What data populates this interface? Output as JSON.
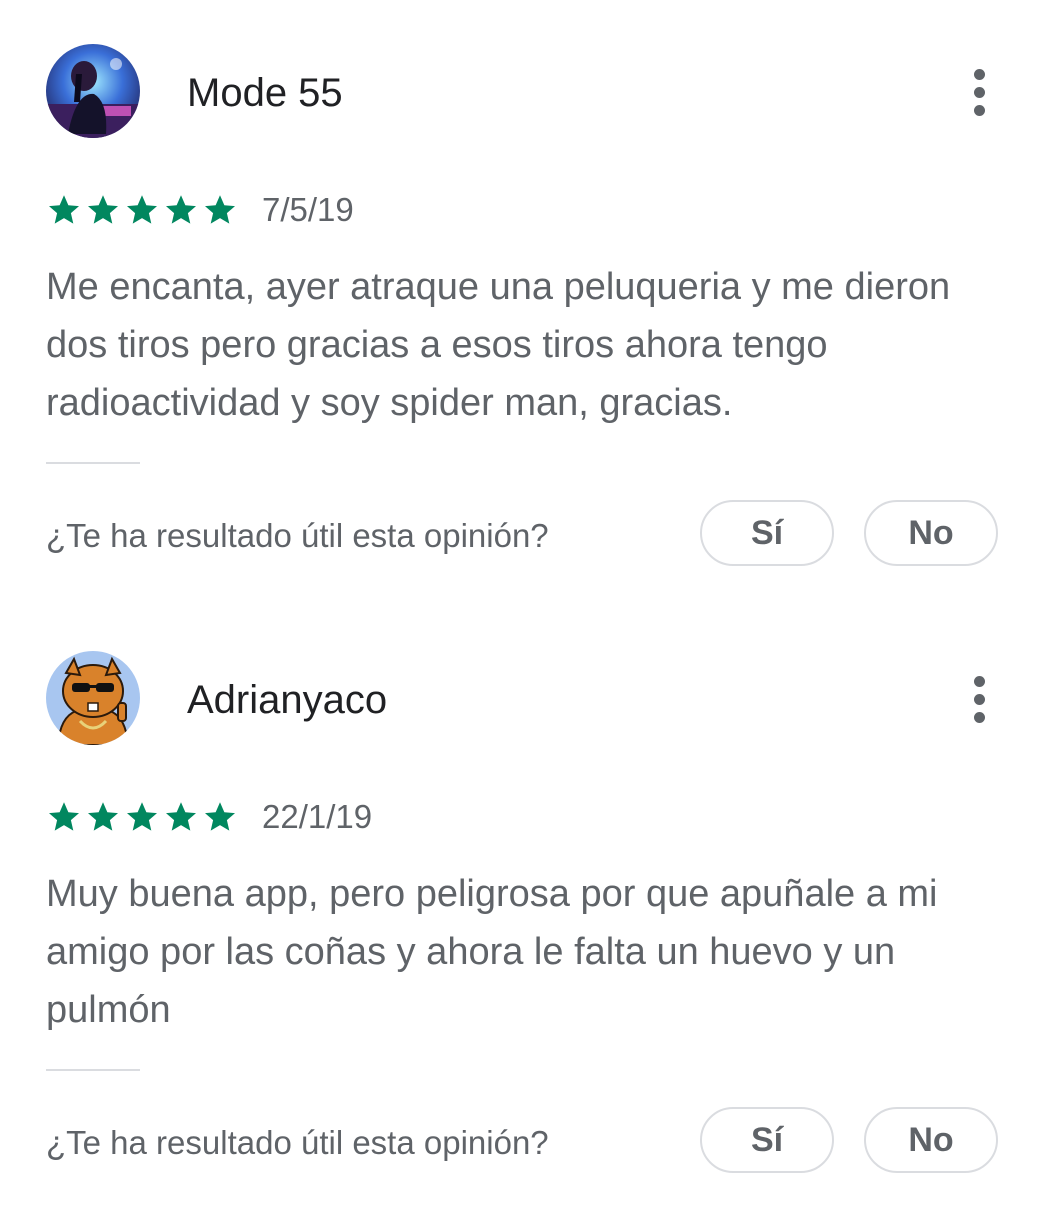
{
  "reviews": [
    {
      "author": "Mode 55",
      "rating": 5,
      "rating_max": 5,
      "date": "7/5/19",
      "text": "Me encanta, ayer atraque una peluqueria y me dieron dos tiros pero gracias a esos tiros ahora tengo radioactividad y soy spider man, gracias.",
      "helpful_question": "¿Te ha resultado útil esta opinión?",
      "yes_label": "Sí",
      "no_label": "No"
    },
    {
      "author": "Adrianyaco",
      "rating": 5,
      "rating_max": 5,
      "date": "22/1/19",
      "text": "Muy buena app, pero peligrosa por que apuñale a mi amigo por las coñas y ahora le falta un huevo y un pulmón",
      "helpful_question": "¿Te ha resultado útil esta opinión?",
      "yes_label": "Sí",
      "no_label": "No"
    }
  ],
  "colors": {
    "star": "#01875f",
    "text_secondary": "#5f6368",
    "divider": "#dadce0"
  },
  "icons": {
    "avatar_1": "avatar-gamer-neon",
    "avatar_2": "avatar-cartoon-squirrel",
    "more": "more-vert-icon",
    "star": "star-icon"
  }
}
